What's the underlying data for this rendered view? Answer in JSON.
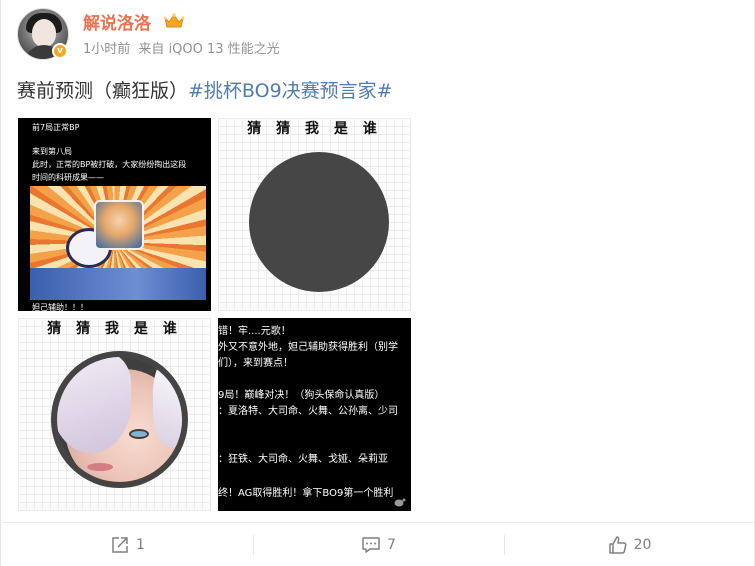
{
  "post": {
    "username": "解说洛洛",
    "time": "1小时前",
    "source": "来自 iQOO 13 性能之光",
    "text_prefix": "赛前预测（癫狂版）",
    "hashtag": "#挑杯BO9决赛预言家#"
  },
  "images": {
    "img1": {
      "lines": [
        "前7局正常BP",
        "来到第八局",
        "此时，正常的BP被打破，大家纷纷掏出这段",
        "时间的科研成果——",
        "妲己辅助！！！"
      ]
    },
    "img2": {
      "title": "猜 猜 我 是 谁"
    },
    "img3": {
      "title": "猜 猜 我 是 谁"
    },
    "img4": {
      "lines": [
        "错！牢....元歌！",
        "外又不意外地，妲己辅助获得胜利（别学",
        "们），来到赛点！",
        "9局！巅峰对决！（狗头保命认真版）",
        "：夏洛特、大司命、火舞、公孙离、少司",
        "：狂铁、大司命、火舞、戈娅、朵莉亚",
        "终！AG取得胜利！拿下BO9第一个胜利"
      ]
    }
  },
  "actions": {
    "share_count": "1",
    "comment_count": "7",
    "like_count": "20"
  },
  "colors": {
    "username": "#eb7350",
    "hashtag": "#507daf",
    "meta": "#939393"
  }
}
